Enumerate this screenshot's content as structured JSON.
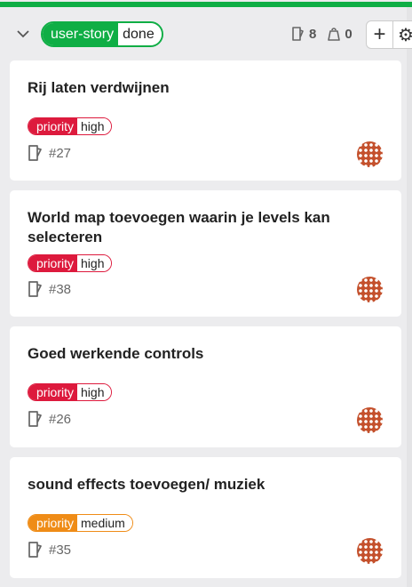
{
  "column": {
    "label_key": "user-story",
    "label_value": "done",
    "issue_count": "8",
    "weight_count": "0",
    "add_icon": "plus-icon",
    "settings_icon": "gear-icon",
    "color": "#0fae45"
  },
  "cards": [
    {
      "title": "Rij laten verdwijnen",
      "priority_key": "priority",
      "priority_value": "high",
      "ref": "#27",
      "color": "#dd1a3d"
    },
    {
      "title": "World map toevoegen waarin je levels kan selecteren",
      "priority_key": "priority",
      "priority_value": "high",
      "ref": "#38",
      "color": "#dd1a3d"
    },
    {
      "title": "Goed werkende controls",
      "priority_key": "priority",
      "priority_value": "high",
      "ref": "#26",
      "color": "#dd1a3d"
    },
    {
      "title": "sound effects toevoegen/ muziek",
      "priority_key": "priority",
      "priority_value": "medium",
      "ref": "#35",
      "color": "#ef8c17"
    }
  ]
}
